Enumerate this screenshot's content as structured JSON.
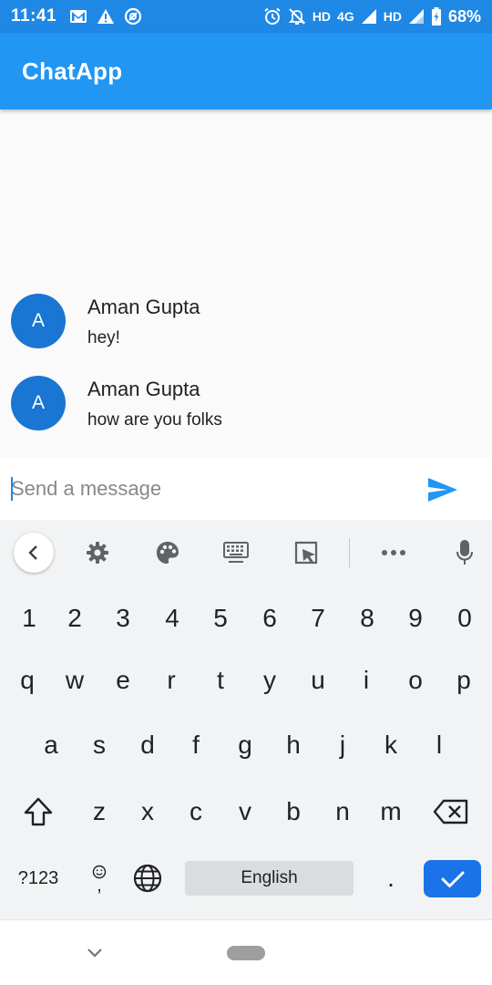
{
  "status_bar": {
    "time": "11:41",
    "network_hd1": "HD",
    "network_4g": "4G",
    "network_hd2": "HD",
    "battery": "68%"
  },
  "app_bar": {
    "title": "ChatApp"
  },
  "messages": [
    {
      "avatar": "A",
      "name": "Aman Gupta",
      "text": "hey!"
    },
    {
      "avatar": "A",
      "name": "Aman Gupta",
      "text": "how are you folks"
    }
  ],
  "composer": {
    "placeholder": "Send a message",
    "value": ""
  },
  "keyboard": {
    "toolbar_icons": [
      "chevron-left-icon",
      "gear-icon",
      "palette-icon",
      "keyboard-icon",
      "cursor-select-icon",
      "more-icon",
      "mic-icon"
    ],
    "row_numbers": [
      "1",
      "2",
      "3",
      "4",
      "5",
      "6",
      "7",
      "8",
      "9",
      "0"
    ],
    "row1": [
      "q",
      "w",
      "e",
      "r",
      "t",
      "y",
      "u",
      "i",
      "o",
      "p"
    ],
    "row2": [
      "a",
      "s",
      "d",
      "f",
      "g",
      "h",
      "j",
      "k",
      "l"
    ],
    "row3": [
      "z",
      "x",
      "c",
      "v",
      "b",
      "n",
      "m"
    ],
    "symbols_label": "?123",
    "comma": ",",
    "space_label": "English",
    "period": "."
  },
  "colors": {
    "status_bar": "#1f88e5",
    "app_bar": "#2196f3",
    "avatar": "#1976d2",
    "enter_key": "#1a73e8",
    "send_icon": "#2196f3"
  }
}
